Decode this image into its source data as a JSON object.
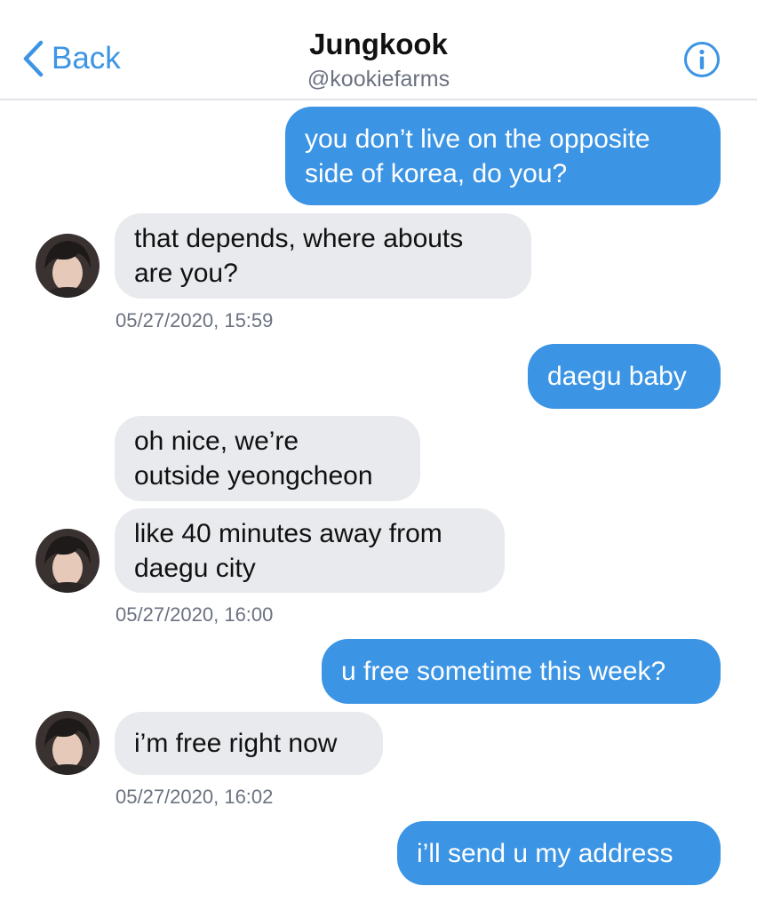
{
  "header": {
    "back_label": "Back",
    "title": "Jungkook",
    "handle": "@kookiefarms",
    "back_icon": "chevron-left-icon",
    "info_icon": "info-icon"
  },
  "colors": {
    "accent": "#3b94e4",
    "received_bubble": "#e8eaed",
    "timestamp": "#6b7280"
  },
  "messages": [
    {
      "from": "me",
      "lines": [
        "you don’t live on the opposite",
        "side of korea, do you?"
      ]
    },
    {
      "from": "them",
      "lines": [
        "that depends, where abouts",
        "are you?"
      ]
    },
    {
      "timestamp": "05/27/2020, 15:59"
    },
    {
      "from": "me",
      "lines": [
        "daegu baby"
      ]
    },
    {
      "from": "them",
      "lines": [
        "oh nice, we’re",
        "outside yeongcheon"
      ]
    },
    {
      "from": "them",
      "lines": [
        "like 40 minutes away from",
        "daegu city"
      ]
    },
    {
      "timestamp": "05/27/2020, 16:00"
    },
    {
      "from": "me",
      "lines": [
        "u free sometime this week?"
      ]
    },
    {
      "from": "them",
      "lines": [
        "i’m free right now"
      ]
    },
    {
      "timestamp": "05/27/2020, 16:02"
    },
    {
      "from": "me",
      "lines": [
        "i’ll send u my address"
      ]
    }
  ]
}
